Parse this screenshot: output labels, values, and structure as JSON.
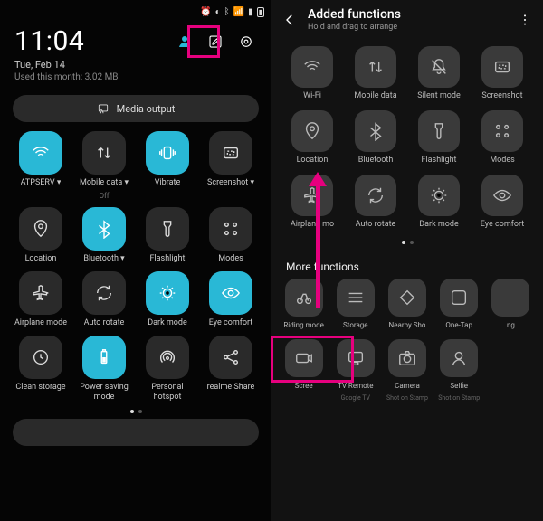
{
  "left": {
    "time": "11:04",
    "date": "Tue, Feb 14",
    "usage": "Used this month: 3.02 MB",
    "media_output": "Media output",
    "tiles": [
      {
        "icon": "wifi",
        "label": "ATPSERV",
        "on": true,
        "drop": true
      },
      {
        "icon": "data",
        "label": "Mobile data",
        "sub": "Off",
        "on": false,
        "drop": true
      },
      {
        "icon": "vibrate",
        "label": "Vibrate",
        "on": true
      },
      {
        "icon": "screenshot",
        "label": "Screenshot",
        "on": false,
        "drop": true
      },
      {
        "icon": "location",
        "label": "Location",
        "on": false
      },
      {
        "icon": "bluetooth",
        "label": "Bluetooth",
        "on": true,
        "drop": true
      },
      {
        "icon": "flashlight",
        "label": "Flashlight",
        "on": false
      },
      {
        "icon": "modes",
        "label": "Modes",
        "on": false
      },
      {
        "icon": "airplane",
        "label": "Airplane mode",
        "on": false,
        "twoLine": true
      },
      {
        "icon": "rotate",
        "label": "Auto rotate",
        "on": false
      },
      {
        "icon": "darkmode",
        "label": "Dark mode",
        "on": true
      },
      {
        "icon": "eyecomfort",
        "label": "Eye comfort",
        "on": true
      },
      {
        "icon": "clean",
        "label": "Clean storage",
        "on": false,
        "twoLine": true
      },
      {
        "icon": "battery",
        "label": "Power saving mode",
        "on": true,
        "twoLine": true
      },
      {
        "icon": "hotspot",
        "label": "Personal hotspot",
        "on": false,
        "twoLine": true
      },
      {
        "icon": "share",
        "label": "realme Share",
        "on": false
      }
    ]
  },
  "right": {
    "title": "Added functions",
    "subtitle": "Hold and drag to arrange",
    "added": [
      {
        "icon": "wifi",
        "label": "Wi-Fi"
      },
      {
        "icon": "data",
        "label": "Mobile data"
      },
      {
        "icon": "silent",
        "label": "Silent mode"
      },
      {
        "icon": "screenshot",
        "label": "Screenshot"
      },
      {
        "icon": "location",
        "label": "Location"
      },
      {
        "icon": "bluetooth",
        "label": "Bluetooth"
      },
      {
        "icon": "flashlight",
        "label": "Flashlight"
      },
      {
        "icon": "modes",
        "label": "Modes"
      },
      {
        "icon": "airplane",
        "label": "Airplane mo"
      },
      {
        "icon": "rotate",
        "label": "Auto rotate"
      },
      {
        "icon": "darkmode",
        "label": "Dark mode"
      },
      {
        "icon": "eyecomfort",
        "label": "Eye comfort"
      }
    ],
    "more_title": "More functions",
    "more": [
      {
        "icon": "ride",
        "label": "Riding mode"
      },
      {
        "icon": "storage",
        "label": "Storage"
      },
      {
        "icon": "nearby",
        "label": "Nearby Sho"
      },
      {
        "icon": "onetap",
        "label": "One-Tap"
      },
      {
        "icon": "blank",
        "label": "ng"
      },
      {
        "icon": "screenrec",
        "label": "Scree"
      },
      {
        "icon": "remote",
        "label": "TV Remote",
        "sub": "Google TV"
      },
      {
        "icon": "camera",
        "label": "Camera",
        "sub": "Shot on Stamp"
      },
      {
        "icon": "selfie",
        "label": "Selfie",
        "sub": "Shot on Stamp"
      }
    ]
  }
}
